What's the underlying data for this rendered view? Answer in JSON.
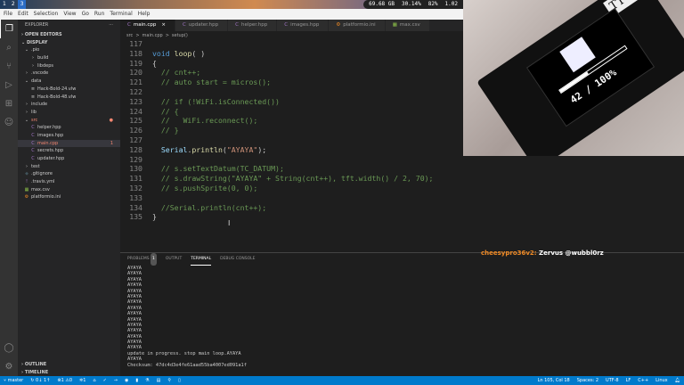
{
  "taskbar": {
    "workspaces": [
      "1",
      "2",
      "3"
    ],
    "active": "3",
    "memory": "69.68 GB",
    "cpu": "30.14%",
    "battery": "82%",
    "load": "1.02"
  },
  "menu": [
    "File",
    "Edit",
    "Selection",
    "View",
    "Go",
    "Run",
    "Terminal",
    "Help"
  ],
  "sidebar": {
    "title": "EXPLORER",
    "more": "···",
    "open_editors": "OPEN EDITORS",
    "project": "DISPLAY",
    "tree": [
      {
        "label": ".pio",
        "indent": 1,
        "kind": "folder-open"
      },
      {
        "label": "build",
        "indent": 2,
        "kind": "folder"
      },
      {
        "label": "libdeps",
        "indent": 2,
        "kind": "folder"
      },
      {
        "label": ".vscode",
        "indent": 1,
        "kind": "folder"
      },
      {
        "label": "data",
        "indent": 1,
        "kind": "folder-open"
      },
      {
        "label": "Hack-Bold-24.vlw",
        "indent": 2,
        "kind": "file"
      },
      {
        "label": "Hack-Bold-48.vlw",
        "indent": 2,
        "kind": "file"
      },
      {
        "label": "include",
        "indent": 1,
        "kind": "folder"
      },
      {
        "label": "lib",
        "indent": 1,
        "kind": "folder"
      },
      {
        "label": "src",
        "indent": 1,
        "kind": "folder-open",
        "state": "err",
        "badge": "●"
      },
      {
        "label": "helper.hpp",
        "indent": 2,
        "kind": "cpp"
      },
      {
        "label": "images.hpp",
        "indent": 2,
        "kind": "cpp"
      },
      {
        "label": "main.cpp",
        "indent": 2,
        "kind": "cpp",
        "state": "err sel",
        "badge": "1"
      },
      {
        "label": "secrets.hpp",
        "indent": 2,
        "kind": "cpp"
      },
      {
        "label": "updater.hpp",
        "indent": 2,
        "kind": "cpp"
      },
      {
        "label": "test",
        "indent": 1,
        "kind": "folder"
      },
      {
        "label": ".gitignore",
        "indent": 1,
        "kind": "git"
      },
      {
        "label": ".travis.yml",
        "indent": 1,
        "kind": "yml"
      },
      {
        "label": "max.csv",
        "indent": 1,
        "kind": "csv"
      },
      {
        "label": "platformio.ini",
        "indent": 1,
        "kind": "ini"
      }
    ],
    "outline": "OUTLINE",
    "timeline": "TIMELINE"
  },
  "tabs": [
    {
      "label": "main.cpp",
      "active": true,
      "close": "×"
    },
    {
      "label": "updater.hpp"
    },
    {
      "label": "helper.hpp"
    },
    {
      "label": "images.hpp"
    },
    {
      "label": "platformio.ini"
    },
    {
      "label": "max.csv"
    }
  ],
  "breadcrumb": [
    "src",
    ">",
    "main.cpp",
    ">",
    "setup()"
  ],
  "code": [
    {
      "n": "117",
      "t": []
    },
    {
      "n": "118",
      "t": [
        [
          "kw",
          "void "
        ],
        [
          "fn",
          "loop"
        ],
        [
          "",
          "( )"
        ]
      ]
    },
    {
      "n": "119",
      "t": [
        [
          "",
          "{"
        ]
      ]
    },
    {
      "n": "120",
      "t": [
        [
          "",
          "  "
        ],
        [
          "cmt",
          "// cnt++;"
        ]
      ]
    },
    {
      "n": "121",
      "t": [
        [
          "",
          "  "
        ],
        [
          "cmt",
          "// auto start = micros();"
        ]
      ]
    },
    {
      "n": "122",
      "t": []
    },
    {
      "n": "123",
      "t": [
        [
          "",
          "  "
        ],
        [
          "cmt",
          "// if (!WiFi.isConnected())"
        ]
      ]
    },
    {
      "n": "124",
      "t": [
        [
          "",
          "  "
        ],
        [
          "cmt",
          "// {"
        ]
      ]
    },
    {
      "n": "125",
      "t": [
        [
          "",
          "  "
        ],
        [
          "cmt",
          "//   WiFi.reconnect();"
        ]
      ]
    },
    {
      "n": "126",
      "t": [
        [
          "",
          "  "
        ],
        [
          "cmt",
          "// }"
        ]
      ]
    },
    {
      "n": "127",
      "t": []
    },
    {
      "n": "128",
      "t": [
        [
          "",
          "  "
        ],
        [
          "id",
          "Serial"
        ],
        [
          "",
          "."
        ],
        [
          "fn",
          "println"
        ],
        [
          "",
          "("
        ],
        [
          "str",
          "\"AYAYA\""
        ],
        [
          "",
          ");"
        ]
      ]
    },
    {
      "n": "129",
      "t": []
    },
    {
      "n": "130",
      "t": [
        [
          "",
          "  "
        ],
        [
          "cmt",
          "// s.setTextDatum(TC_DATUM);"
        ]
      ]
    },
    {
      "n": "131",
      "t": [
        [
          "",
          "  "
        ],
        [
          "cmt",
          "// s.drawString(\"AYAYA\" + String(cnt++), tft.width() / 2, 70);"
        ]
      ]
    },
    {
      "n": "132",
      "t": [
        [
          "",
          "  "
        ],
        [
          "cmt",
          "// s.pushSprite(0, 0);"
        ]
      ]
    },
    {
      "n": "133",
      "t": []
    },
    {
      "n": "134",
      "t": [
        [
          "",
          "  "
        ],
        [
          "cmt",
          "//Serial.println(cnt++);"
        ]
      ]
    },
    {
      "n": "135",
      "t": [
        [
          "",
          "}"
        ]
      ]
    }
  ],
  "webcam": {
    "brand": "TTGO",
    "progress_text": "42 / 100%",
    "progress": 0.42
  },
  "panel": {
    "tabs": [
      "PROBLEMS",
      "OUTPUT",
      "TERMINAL",
      "DEBUG CONSOLE"
    ],
    "problems_count": "1",
    "active": "TERMINAL"
  },
  "terminal": [
    "AYAYA",
    "AYAYA",
    "AYAYA",
    "AYAYA",
    "AYAYA",
    "AYAYA",
    "AYAYA",
    "AYAYA",
    "AYAYA",
    "AYAYA",
    "AYAYA",
    "AYAYA",
    "AYAYA",
    "AYAYA",
    "AYAYA",
    "update in progress. stop main loop.AYAYA",
    "AYAYA",
    "Checksum: 47dc4d3e4fe61aad55ba4007ed091a1f"
  ],
  "chat": {
    "user": "cheesypro36v2:",
    "message": "Zervus @wubbl0rz"
  },
  "status": {
    "branch": "master",
    "sync": "0↓ 1↑",
    "errors": "1",
    "warnings": "0",
    "pio": "1",
    "position": "Ln 105, Col 18",
    "spaces": "Spaces: 2",
    "encoding": "UTF-8",
    "eol": "LF",
    "language": "C++",
    "os": "Linux"
  }
}
